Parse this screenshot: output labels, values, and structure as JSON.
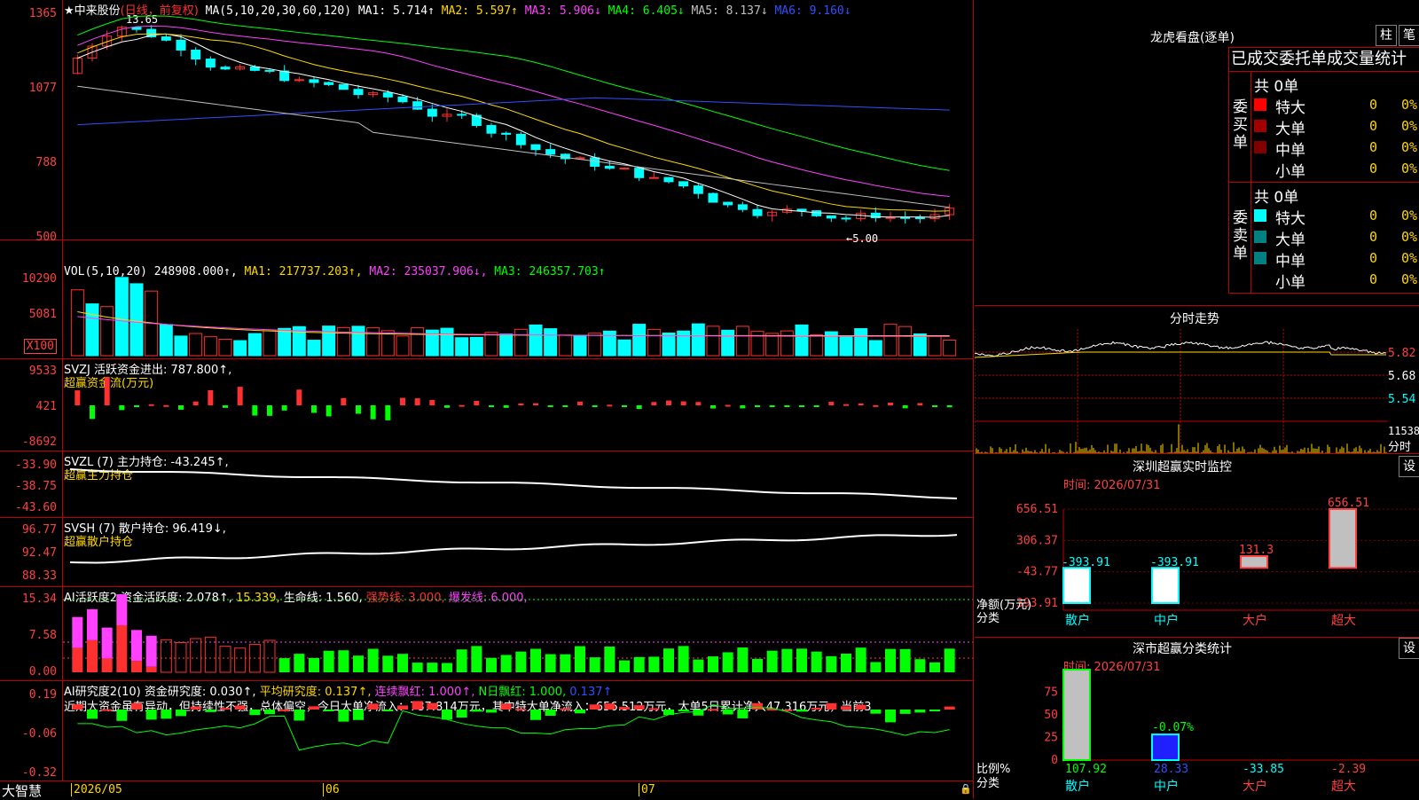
{
  "kline": {
    "name": "中来股份",
    "star": "★",
    "period_label": "(日线，前复权)",
    "ma_params": "MA(5,10,20,30,60,120)",
    "ma1": "MA1: 5.714↑",
    "ma2": "MA2: 5.597↑",
    "ma3": "MA3: 5.906↓",
    "ma4": "MA4: 6.405↓",
    "ma5": "MA5: 8.137↓",
    "ma6": "MA6: 9.160↓",
    "high_label": "13.65",
    "low_label": "←5.00",
    "yticks": [
      "1365",
      "1077",
      "788",
      "500"
    ]
  },
  "vol": {
    "params": "VOL(5,10,20)",
    "value": "248908.000↑",
    "ma1": "MA1: 217737.203↑",
    "ma2": "MA2: 235037.906↓",
    "ma3": "MA3: 246357.703↑",
    "yticks": [
      "10290",
      "5081"
    ],
    "unit": "X100"
  },
  "svzj": {
    "title": "SVZJ  活跃资金进出: 787.800↑,",
    "subtitle": "超赢资金流(万元)",
    "yticks": [
      "9533",
      "421",
      "-8692"
    ]
  },
  "svzl": {
    "title": "SVZL (7) 主力持仓: -43.245↑,",
    "subtitle": "超赢主力持仓",
    "yticks": [
      "-33.90",
      "-38.75",
      "-43.60"
    ]
  },
  "svsh": {
    "title": "SVSH (7) 散户持仓: 96.419↓,",
    "subtitle": "超赢散户持仓",
    "yticks": [
      "96.77",
      "92.47",
      "88.33"
    ]
  },
  "ai1": {
    "t1": "AI活跃度2 资金活跃度: 2.078↑,",
    "t2": "15.339,",
    "t3": "生命线: 1.560,",
    "t4": "强势线: 3.000,",
    "t5": "爆发线: 6.000,",
    "yticks": [
      "15.34",
      "7.58",
      "0.00"
    ]
  },
  "ai2": {
    "t1": "AI研究度2(10) 资金研究度: 0.030↑,",
    "t2": "平均研究度: 0.137↑,",
    "t3": "连续飘红: 1.000↑,",
    "t4": "N日飘红: 1.000,",
    "t5": "0.137↑",
    "commentary": "近期大资金虽有异动，但持续性不强，总体偏空，今日大单净流入：787.814万元，其中特大单净流入：656.512万元，大单5日累计净入47.316万元，当前3",
    "yticks": [
      "0.19",
      "-0.06",
      "-0.32"
    ]
  },
  "footer": {
    "brand": "大智慧",
    "dates": [
      "2026/05",
      "06",
      "07"
    ]
  },
  "lhb": {
    "title": "龙虎看盘(逐单)",
    "btn1": "柱",
    "btn2": "笔",
    "header": "已成交委托单成交量统计",
    "buy": {
      "label": "委买单",
      "total": "共 0单",
      "rows": [
        {
          "name": "特大",
          "v": "0",
          "p": "0%",
          "color": "#ff0000"
        },
        {
          "name": "大单",
          "v": "0",
          "p": "0%",
          "color": "#a00000"
        },
        {
          "name": "中单",
          "v": "0",
          "p": "0%",
          "color": "#800000"
        },
        {
          "name": "小单",
          "v": "0",
          "p": "0%",
          "color": ""
        }
      ]
    },
    "sell": {
      "label": "委卖单",
      "total": "共 0单",
      "rows": [
        {
          "name": "特大",
          "v": "0",
          "p": "0%",
          "color": "#00ffff"
        },
        {
          "name": "大单",
          "v": "0",
          "p": "0%",
          "color": "#008080"
        },
        {
          "name": "中单",
          "v": "0",
          "p": "0%",
          "color": "#008080"
        },
        {
          "name": "小单",
          "v": "0",
          "p": "0%",
          "color": ""
        }
      ]
    }
  },
  "fenshi": {
    "title": "分时走势",
    "yticks": [
      "5.82",
      "5.68",
      "5.54"
    ],
    "vol_tick": "11538",
    "vol_label": "分时"
  },
  "monitor": {
    "title": "深圳超赢实时监控",
    "btn": "设",
    "time": "时间: 2026/07/31",
    "yticks": [
      "656.51",
      "306.37",
      "-43.77",
      "-393.91"
    ],
    "ylabel1": "净额(万元)",
    "ylabel2": "分类",
    "bars": [
      {
        "label": "散户",
        "value": -393.91,
        "text": "-393.91"
      },
      {
        "label": "中户",
        "value": -393.91,
        "text": "-393.91"
      },
      {
        "label": "大户",
        "value": 131.3,
        "text": "131.3"
      },
      {
        "label": "超大",
        "value": 656.51,
        "text": "656.51"
      }
    ]
  },
  "classify": {
    "title": "深市超赢分类统计",
    "btn": "设",
    "time": "时间: 2026/07/31",
    "yticks": [
      "75",
      "50",
      "25",
      "0"
    ],
    "ylabel1": "比例%",
    "ylabel2": "分类",
    "annot": "-0.07%",
    "bars": [
      {
        "label": "散户",
        "value": 107.92,
        "text": "107.92"
      },
      {
        "label": "中户",
        "value": 28.33,
        "text": "28.33"
      },
      {
        "label": "大户",
        "value": -33.85,
        "text": "-33.85"
      },
      {
        "label": "超大",
        "value": -2.39,
        "text": "-2.39"
      }
    ]
  },
  "chart_data": {
    "type": "bar",
    "title": "深圳超赢实时监控",
    "categories": [
      "散户",
      "中户",
      "大户",
      "超大"
    ],
    "values": [
      -393.91,
      -393.91,
      131.3,
      656.51
    ],
    "ylabel": "净额(万元)",
    "ylim": [
      -393.91,
      656.51
    ]
  },
  "colors": {
    "up": "#ff3030",
    "down": "#00ffff",
    "grid": "#c00000"
  }
}
